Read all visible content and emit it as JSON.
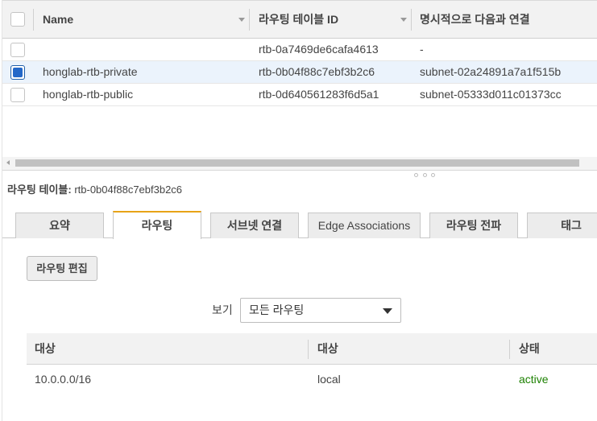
{
  "route_tables": {
    "columns": {
      "name": "Name",
      "route_table_id": "라우팅 테이블 ID",
      "explicit_association": "명시적으로 다음과 연결"
    },
    "rows": [
      {
        "name": "",
        "route_table_id": "rtb-0a7469de6cafa4613",
        "association": "-",
        "selected": false
      },
      {
        "name": "honglab-rtb-private",
        "route_table_id": "rtb-0b04f88c7ebf3b2c6",
        "association": "subnet-02a24891a7a1f515b",
        "selected": true
      },
      {
        "name": "honglab-rtb-public",
        "route_table_id": "rtb-0d640561283f6d5a1",
        "association": "subnet-05333d011c01373cc",
        "selected": false
      }
    ]
  },
  "detail": {
    "label": "라우팅 테이블:",
    "value": "rtb-0b04f88c7ebf3b2c6"
  },
  "tabs": [
    {
      "label": "요약",
      "active": false
    },
    {
      "label": "라우팅",
      "active": true
    },
    {
      "label": "서브넷 연결",
      "active": false
    },
    {
      "label": "Edge Associations",
      "active": false
    },
    {
      "label": "라우팅 전파",
      "active": false
    },
    {
      "label": "태그",
      "active": false
    }
  ],
  "routes_panel": {
    "edit_button": "라우팅 편집",
    "view_label": "보기",
    "view_select_value": "모든 라우팅",
    "columns": {
      "destination": "대상",
      "target": "대상",
      "status": "상태"
    },
    "rows": [
      {
        "destination": "10.0.0.0/16",
        "target": "local",
        "status": "active"
      }
    ]
  },
  "colors": {
    "accent_tab": "#e8a317",
    "selected_row": "#ebf3fc",
    "checkbox_checked": "#2468c8",
    "status_active": "#1d8102"
  }
}
